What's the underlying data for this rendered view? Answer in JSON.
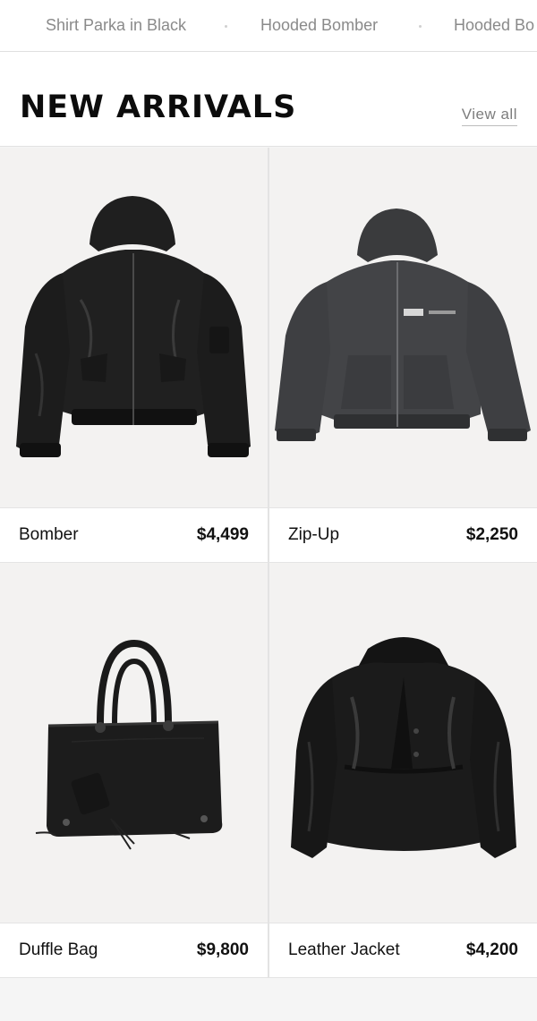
{
  "top_strip": {
    "items": [
      {
        "label": "Shirt Parka in Black"
      },
      {
        "label": "Hooded Bomber"
      },
      {
        "label": "Hooded Bo"
      }
    ]
  },
  "section": {
    "title": "NEW ARRIVALS",
    "view_all": "View all"
  },
  "products": [
    {
      "name": "Bomber",
      "price": "$4,499",
      "image_icon": "bomber-jacket-icon"
    },
    {
      "name": "Zip-Up",
      "price": "$2,250",
      "image_icon": "zip-hoodie-icon"
    },
    {
      "name": "Duffle Bag",
      "price": "$9,800",
      "image_icon": "handbag-icon"
    },
    {
      "name": "Leather Jacket",
      "price": "$4,200",
      "image_icon": "leather-jacket-icon"
    }
  ],
  "colors": {
    "background": "#f5f5f5",
    "card_bg": "#f3f2f1",
    "text": "#111111",
    "muted": "#8a8a8a"
  }
}
